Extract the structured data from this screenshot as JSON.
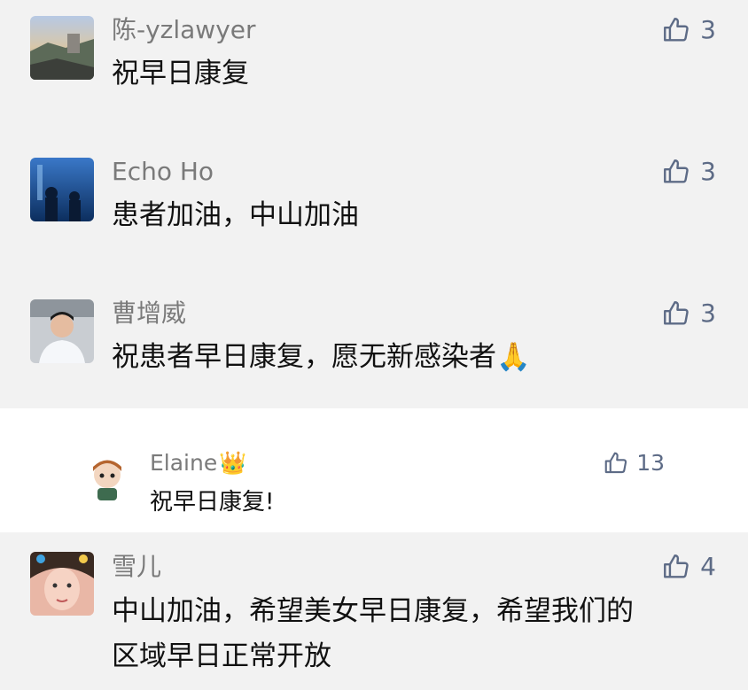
{
  "comments": [
    {
      "name": "陈-yzlawyer",
      "text": "祝早日康复",
      "likes": "3",
      "avatar": "coastal-landscape-avatar"
    },
    {
      "name": "Echo Ho",
      "text": "患者加油，中山加油",
      "likes": "3",
      "avatar": "aquarium-silhouette-avatar"
    },
    {
      "name": "曹增威",
      "text": "祝患者早日康复，愿无新感染者",
      "likes": "3",
      "avatar": "man-portrait-avatar",
      "emoji": "🙏"
    },
    {
      "name": "雪儿",
      "text_line1": "中山加油，希望美女早日康复，希望我们的",
      "text_line2": "区域早日正常开放",
      "likes": "4",
      "avatar": "woman-portrait-avatar"
    }
  ],
  "reply": {
    "name": "Elaine",
    "crown": "👑",
    "text": "祝早日康复!",
    "likes": "13",
    "avatar": "cartoon-avatar"
  },
  "colors": {
    "band": "#f2f2f2",
    "name": "#7a7a7a",
    "text": "#111111",
    "like": "#5d6b86"
  },
  "icons": {
    "like": "thumbs-up-icon"
  }
}
